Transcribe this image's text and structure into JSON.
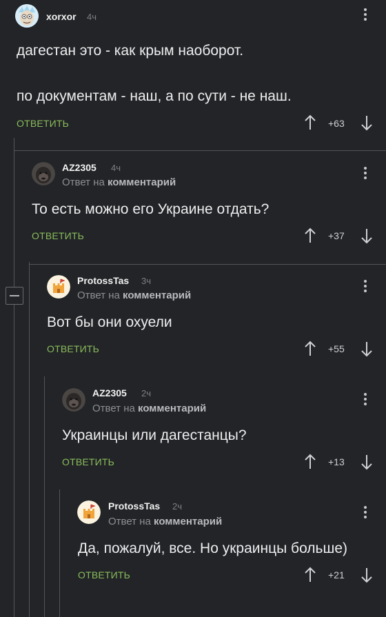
{
  "reply_label": "ОТВЕТИТЬ",
  "reply_to_prefix": "Ответ на",
  "reply_to_target": "комментарий",
  "comments": [
    {
      "user": "xorxor",
      "time": "4ч",
      "text_lines": [
        "дагестан это - как крым наоборот.",
        "по документам - наш, а по сути - не наш."
      ],
      "rating": "+63",
      "avatar_icon": "rick-avatar"
    },
    {
      "user": "AZ2305",
      "time": "4ч",
      "text_lines": [
        "То есть можно его Украине отдать?"
      ],
      "rating": "+37",
      "avatar_icon": "gorilla-avatar"
    },
    {
      "user": "ProtossTas",
      "time": "3ч",
      "text_lines": [
        "Вот бы они охуели"
      ],
      "rating": "+55",
      "avatar_icon": "castle-avatar"
    },
    {
      "user": "AZ2305",
      "time": "2ч",
      "text_lines": [
        "Украинцы или дагестанцы?"
      ],
      "rating": "+13",
      "avatar_icon": "gorilla-avatar"
    },
    {
      "user": "ProtossTas",
      "time": "2ч",
      "text_lines": [
        "Да, пожалуй, все. Но украинцы больше)"
      ],
      "rating": "+21",
      "avatar_icon": "castle-avatar"
    }
  ],
  "colors": {
    "background": "#222427",
    "reply_link": "#8bbd5c",
    "thread_line": "#53565a"
  }
}
